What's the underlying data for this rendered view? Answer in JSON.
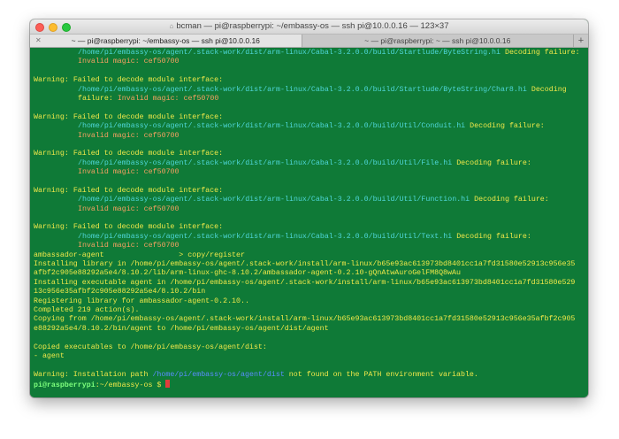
{
  "window": {
    "title": "bcman — pi@raspberrypi: ~/embassy-os — ssh pi@10.0.0.16 — 123×37",
    "tabs": [
      {
        "label": "~ — pi@raspberrypi: ~/embassy-os — ssh pi@10.0.0.16",
        "active": true
      },
      {
        "label": "~ — pi@raspberrypi: ~ — ssh pi@10.0.0.16",
        "active": false
      }
    ],
    "new_tab_label": "+",
    "background_color": "#0f7a37"
  },
  "terminal": {
    "warning_label": "Warning:",
    "warning_text": "Failed to decode module interface:",
    "decoding_failure": "Decoding failure:",
    "invalid_magic": "Invalid magic: cef50700",
    "top_path": "/home/pi/embassy-os/agent/.stack-work/dist/arm-linux/Cabal-3.2.0.0/build/Startlude/ByteString.hi",
    "blocks": [
      {
        "path": "/home/pi/embassy-os/agent/.stack-work/dist/arm-linux/Cabal-3.2.0.0/build/Startlude/ByteString/Char8.hi",
        "suffix": "Decoding",
        "wrap": "failure:"
      },
      {
        "path": "/home/pi/embassy-os/agent/.stack-work/dist/arm-linux/Cabal-3.2.0.0/build/Util/Conduit.hi",
        "suffix": "Decoding failure:"
      },
      {
        "path": "/home/pi/embassy-os/agent/.stack-work/dist/arm-linux/Cabal-3.2.0.0/build/Util/File.hi",
        "suffix": "Decoding failure:"
      },
      {
        "path": "/home/pi/embassy-os/agent/.stack-work/dist/arm-linux/Cabal-3.2.0.0/build/Util/Function.hi",
        "suffix": "Decoding failure:"
      },
      {
        "path": "/home/pi/embassy-os/agent/.stack-work/dist/arm-linux/Cabal-3.2.0.0/build/Util/Text.hi",
        "suffix": "Decoding failure:"
      }
    ],
    "output_lines": [
      "ambassador-agent                 > copy/register",
      "Installing library in /home/pi/embassy-os/agent/.stack-work/install/arm-linux/b65e93ac613973bd8401cc1a7fd31580e52913c956e35",
      "afbf2c905e88292a5e4/8.10.2/lib/arm-linux-ghc-8.10.2/ambassador-agent-0.2.10-gQnAtwAuroGelFM8Q8wAu",
      "Installing executable agent in /home/pi/embassy-os/agent/.stack-work/install/arm-linux/b65e93ac613973bd8401cc1a7fd31580e529",
      "13c956e35afbf2c905e88292a5e4/8.10.2/bin",
      "Registering library for ambassador-agent-0.2.10..",
      "Completed 219 action(s).",
      "Copying from /home/pi/embassy-os/agent/.stack-work/install/arm-linux/b65e93ac613973bd8401cc1a7fd31580e52913c956e35afbf2c905",
      "e88292a5e4/8.10.2/bin/agent to /home/pi/embassy-os/agent/dist/agent",
      "",
      "Copied executables to /home/pi/embassy-os/agent/dist:",
      "- agent",
      ""
    ],
    "final_warning_prefix": "Warning: Installation path ",
    "final_warning_path": "/home/pi/embassy-os/agent/dist",
    "final_warning_suffix": " not found on the PATH environment variable.",
    "prompt_user": "pi@raspberrypi",
    "prompt_dir": ":~/embassy-os $ "
  }
}
